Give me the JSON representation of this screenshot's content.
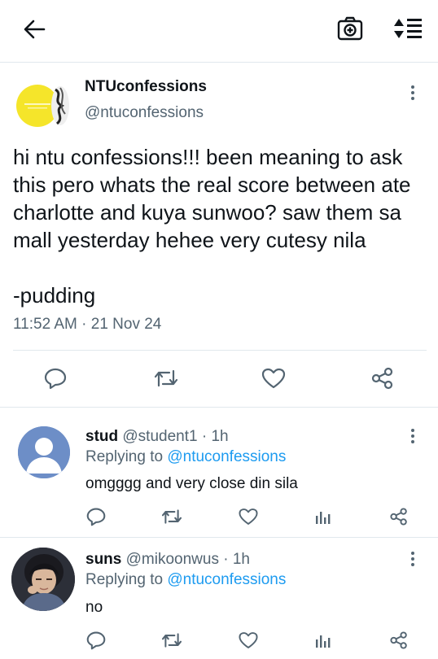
{
  "header": {
    "back_icon": "arrow-left-icon",
    "camera_icon": "camera-plus-icon",
    "sort_icon": "sort-list-icon"
  },
  "tweet": {
    "name": "NTUconfessions",
    "handle": "@ntuconfessions",
    "avatar_color": "#f5e52a",
    "text": "hi ntu confessions!!! been meaning to ask this pero whats the real score between ate charlotte and kuya sunwoo? saw them sa mall yesterday hehee very cutesy nila\n\n-pudding",
    "time": "11:52 AM",
    "separator": " · ",
    "date": "21 Nov 24",
    "actions": [
      "reply-icon",
      "retweet-icon",
      "like-icon",
      "share-icon"
    ]
  },
  "replies": [
    {
      "name": "stud",
      "handle": "@student1",
      "time_sep": " · ",
      "time": "1h",
      "replying_prefix": "Replying to ",
      "replying_to": "@ntuconfessions",
      "text": "omgggg and very close din sila",
      "avatar": "default-avatar-icon"
    },
    {
      "name": "suns",
      "handle": "@mikoonwus",
      "time_sep": " · ",
      "time": "1h",
      "replying_prefix": "Replying to ",
      "replying_to": "@ntuconfessions",
      "text": "no",
      "avatar": "user-photo"
    }
  ],
  "colors": {
    "accent": "#1d9bf0",
    "muted": "#536471",
    "border": "#e1e8ed"
  }
}
